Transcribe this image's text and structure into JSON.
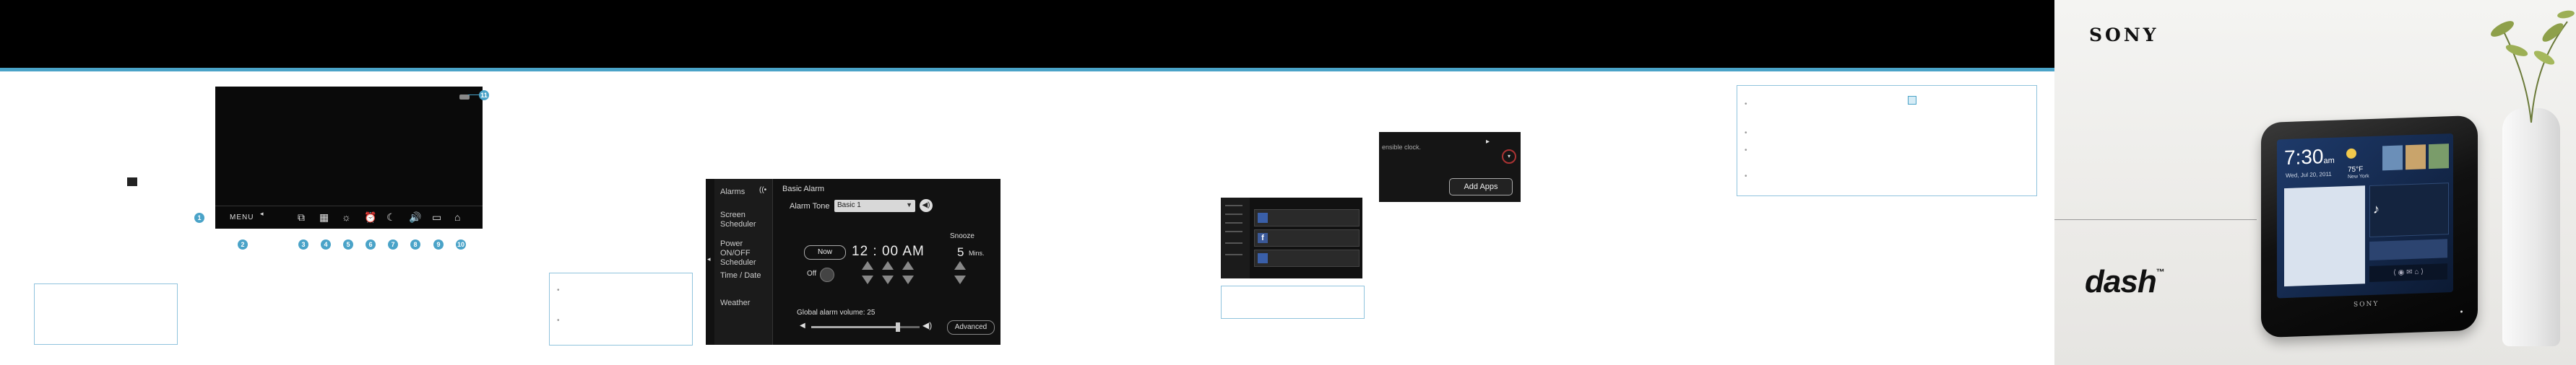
{
  "brand": {
    "logo": "SONY",
    "product": "dash",
    "trademark": "™"
  },
  "panel1": {
    "menu_label": "MENU",
    "callouts": [
      "1",
      "2",
      "3",
      "4",
      "5",
      "6",
      "7",
      "8",
      "9",
      "10",
      "11"
    ]
  },
  "alarm_panel": {
    "sidebar": [
      "Alarms",
      "Screen Scheduler",
      "Power ON/OFF Scheduler",
      "Time / Date",
      "Weather"
    ],
    "title": "Basic Alarm",
    "tone_label": "Alarm Tone",
    "tone_value": "Basic 1",
    "now_button": "Now",
    "time": "12 : 00  AM",
    "snooze_label": "Snooze",
    "snooze_value": "5",
    "snooze_unit": "Mins.",
    "off_label": "Off",
    "volume_label": "Global alarm volume:  25",
    "advanced_button": "Advanced"
  },
  "apps_panel": {
    "clock_text": "ensible clock.",
    "add_apps_button": "Add Apps"
  },
  "device": {
    "time": "7:30",
    "ampm": "am",
    "date": "Wed, Jul 20, 2011",
    "temp": "75°F",
    "city": "New York",
    "brand": "SONY"
  },
  "colors": {
    "accent": "#4aa3c8",
    "topbar": "#000000"
  }
}
